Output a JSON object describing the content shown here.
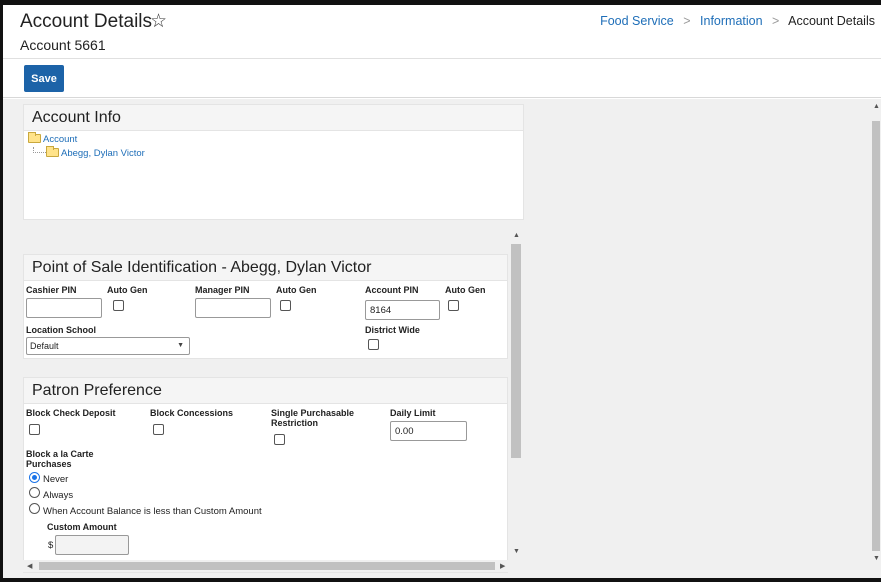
{
  "header": {
    "title": "Account Details",
    "star_icon": "☆",
    "subtitle": "Account 5661",
    "breadcrumb": {
      "item1": "Food Service",
      "item2": "Information",
      "separator": ">",
      "current": "Account Details"
    }
  },
  "toolbar": {
    "save_label": "Save"
  },
  "account_info": {
    "title": "Account Info",
    "tree_root": "Account",
    "tree_child": "Abegg, Dylan Victor"
  },
  "pos": {
    "title": "Point of Sale Identification - Abegg, Dylan Victor",
    "cashier_pin_label": "Cashier PIN",
    "cashier_pin_value": "",
    "auto_gen_label": "Auto Gen",
    "manager_pin_label": "Manager PIN",
    "manager_pin_value": "",
    "account_pin_label": "Account PIN",
    "account_pin_value": "8164",
    "location_school_label": "Location School",
    "location_school_value": "Default",
    "district_wide_label": "District Wide"
  },
  "patron": {
    "title": "Patron Preference",
    "block_check_label": "Block Check Deposit",
    "block_concessions_label": "Block Concessions",
    "single_purchasable_label": "Single Purchasable Restriction",
    "daily_limit_label": "Daily Limit",
    "daily_limit_value": "0.00",
    "block_alacarte_label": "Block a la Carte Purchases",
    "options": [
      "Never",
      "Always",
      "When Account Balance is less than Custom Amount"
    ],
    "selected_option": "Never",
    "custom_amount_label": "Custom Amount",
    "currency_symbol": "$",
    "custom_amount_value": ""
  },
  "colors": {
    "accent": "#1c63a8",
    "link": "#1e6eb8",
    "radio_selected": "#1a73e8"
  }
}
